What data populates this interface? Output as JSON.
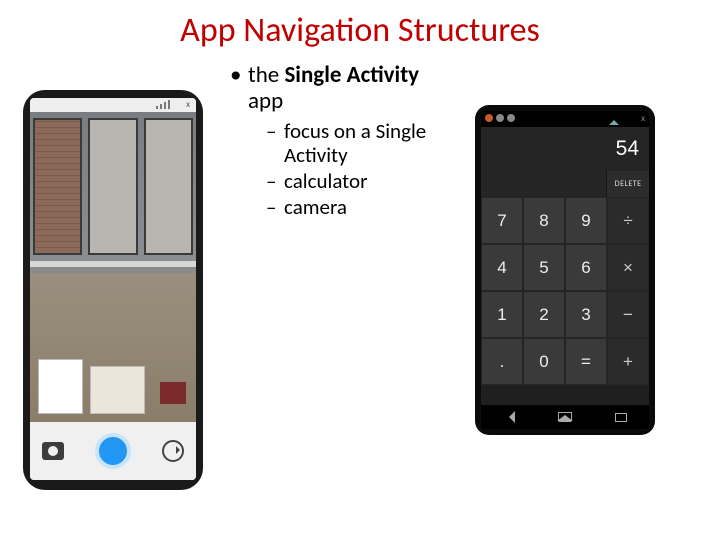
{
  "title": "App Navigation Structures",
  "bullet": {
    "prefix": "the ",
    "bold": "Single Activity",
    "suffix": " app"
  },
  "sub": {
    "a": "focus on a Single Activity",
    "b": "calculator",
    "c": "camera"
  },
  "camera": {
    "status_x": "x"
  },
  "calculator": {
    "status_x": "x",
    "display": "54",
    "delete": "DELETE",
    "keys": {
      "r1": [
        "7",
        "8",
        "9",
        "÷"
      ],
      "r2": [
        "4",
        "5",
        "6",
        "×"
      ],
      "r3": [
        "1",
        "2",
        "3",
        "−"
      ],
      "r4": [
        ".",
        "0",
        "=",
        "+"
      ]
    }
  }
}
